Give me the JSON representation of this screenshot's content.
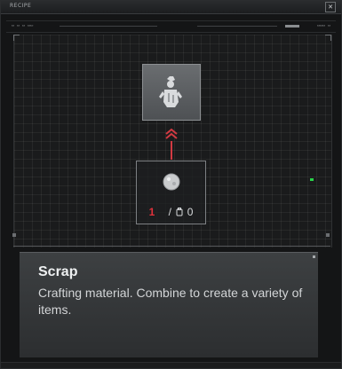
{
  "window": {
    "title": "RECIPE",
    "close_label": "✕"
  },
  "toolbar": {
    "left_text": "▭ ▭ ▭ ▭▭",
    "right_text": "▭▭▭ ▭"
  },
  "recipe": {
    "result_item_icon": "scrap-figure-icon",
    "arrow_icon": "double-chevron-up-icon",
    "material_icon": "scrap-material-icon",
    "count_have": "1",
    "count_separator": "/",
    "inventory_icon": "inventory-bag-icon",
    "count_stock": "0"
  },
  "description": {
    "title": "Scrap",
    "body": "Crafting material. Combine to create a variety of items."
  },
  "colors": {
    "accent_red": "#e0323c",
    "connector_red": "#d23a42",
    "marker_green": "#29d34a",
    "panel_bg": "#3d4042"
  }
}
